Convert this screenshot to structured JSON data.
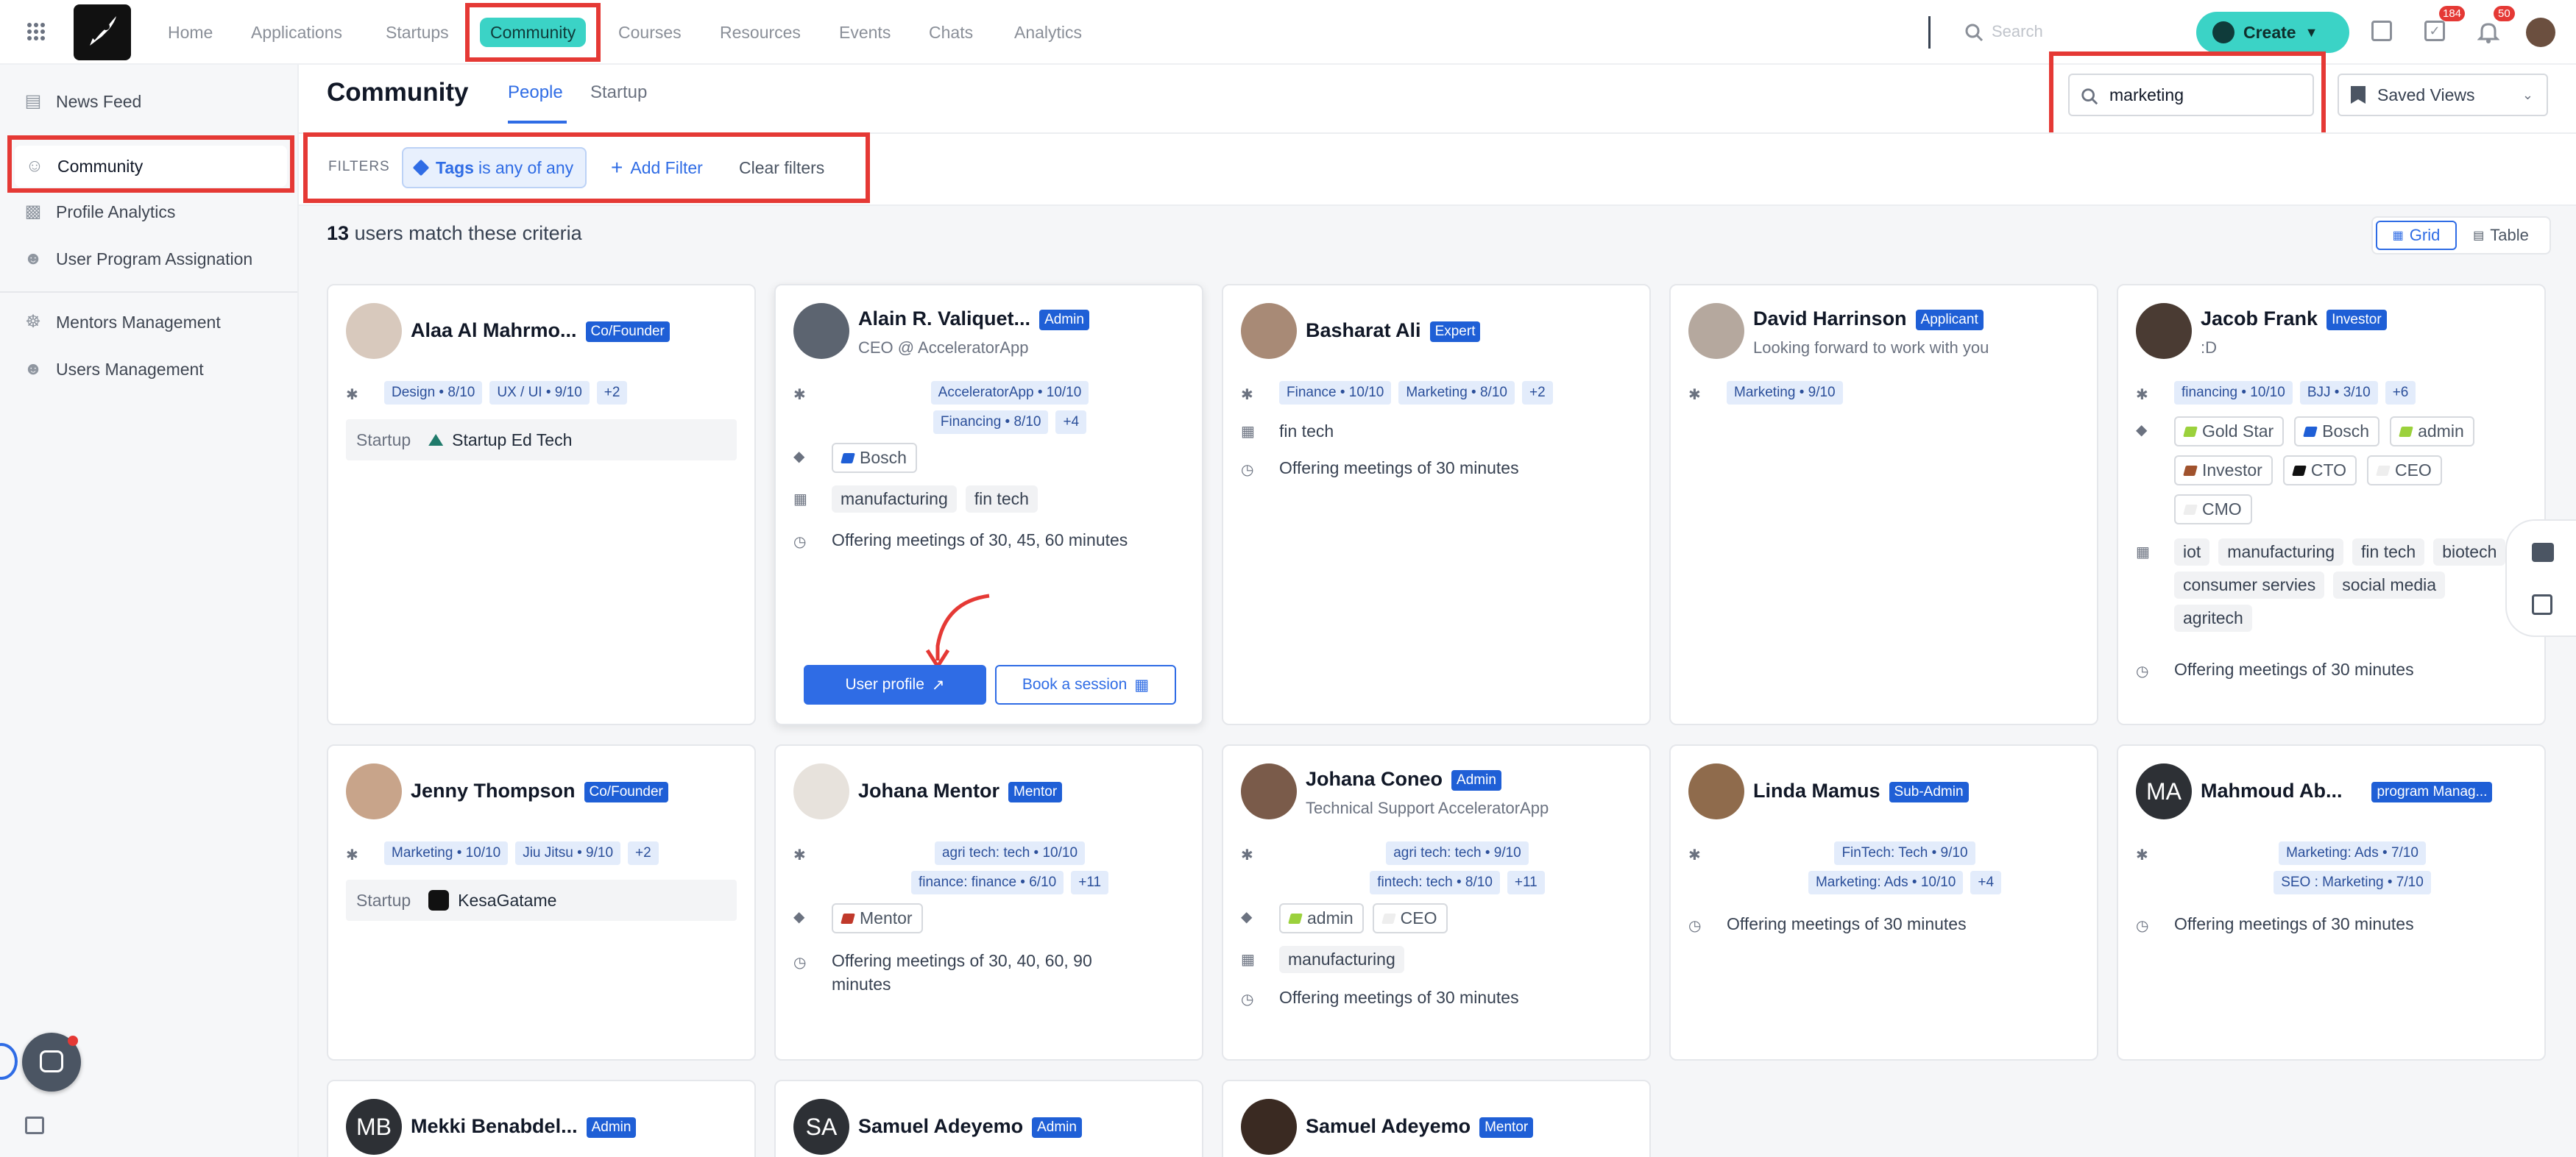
{
  "nav": {
    "items": [
      "Home",
      "Applications",
      "Startups",
      "Community",
      "Courses",
      "Resources",
      "Events",
      "Chats",
      "Analytics"
    ],
    "active": "Community",
    "search_placeholder": "Search",
    "create_label": "Create",
    "tasks_badge": "184",
    "notifications_badge": "50"
  },
  "sidebar": {
    "items": [
      "News Feed",
      "Community",
      "Profile Analytics",
      "User Program Assignation",
      "Mentors Management",
      "Users Management"
    ],
    "active": "Community"
  },
  "header": {
    "title": "Community",
    "tabs": [
      "People",
      "Startup"
    ],
    "active_tab": "People",
    "search_value": "marketing",
    "saved_views": "Saved Views"
  },
  "filters": {
    "label": "FILTERS",
    "tag_filter_key": "Tags",
    "tag_filter_rest": "is any of any",
    "add_filter": "Add Filter",
    "clear_filters": "Clear filters"
  },
  "results": {
    "count": "13",
    "text": "users match these criteria",
    "view_grid": "Grid",
    "view_table": "Table"
  },
  "colors": {
    "accent": "#2f6ce5",
    "nav_active": "#3bd3c6",
    "create": "#3bd3c6",
    "role_badge": "#1f5fd6",
    "highlight_box": "#e53935"
  },
  "cards": [
    {
      "name": "Alaa Al Mahrmo...",
      "role": "Co/Founder",
      "subtitle": "",
      "skills": [
        "Design • 8/10",
        "UX / UI • 9/10",
        "+2"
      ],
      "tags": [],
      "industries": [],
      "meetings": "",
      "startup_label": "Startup",
      "startup": "Startup Ed Tech"
    },
    {
      "name": "Alain R. Valiquet...",
      "role": "Admin",
      "subtitle": "CEO @ AcceleratorApp",
      "skills": [
        "AcceleratorApp • 10/10",
        "Financing • 8/10",
        "+4"
      ],
      "tags": [
        "Bosch"
      ],
      "industries": [
        "manufacturing",
        "fin tech"
      ],
      "meetings": "Offering meetings of 30, 45, 60 minutes",
      "btn_profile": "User profile",
      "btn_book": "Book a session"
    },
    {
      "name": "Basharat Ali",
      "role": "Expert",
      "subtitle": "",
      "skills": [
        "Finance • 10/10",
        "Marketing • 8/10",
        "+2"
      ],
      "tags": [],
      "industries": [
        "fin tech"
      ],
      "meetings": "Offering meetings of 30 minutes"
    },
    {
      "name": "David Harrinson",
      "role": "Applicant",
      "subtitle": "Looking forward to work with you",
      "skills": [
        "Marketing • 9/10"
      ],
      "tags": [],
      "industries": [],
      "meetings": ""
    },
    {
      "name": "Jacob Frank",
      "role": "Investor",
      "subtitle": ":D",
      "skills": [
        "financing • 10/10",
        "BJJ • 3/10",
        "+6"
      ],
      "tags": [
        "Gold Star",
        "Bosch",
        "admin",
        "Investor",
        "CTO",
        "CEO",
        "CMO"
      ],
      "industries": [
        "iot",
        "manufacturing",
        "fin tech",
        "biotech",
        "consumer servies",
        "social media",
        "agritech"
      ],
      "meetings": "Offering meetings of 30 minutes"
    },
    {
      "name": "Jenny Thompson",
      "role": "Co/Founder",
      "subtitle": "",
      "skills": [
        "Marketing • 10/10",
        "Jiu Jitsu • 9/10",
        "+2"
      ],
      "tags": [],
      "industries": [],
      "meetings": "",
      "startup_label": "Startup",
      "startup": "KesaGatame"
    },
    {
      "name": "Johana Mentor",
      "role": "Mentor",
      "subtitle": "",
      "skills": [
        "agri tech: tech • 10/10",
        "finance: finance • 6/10",
        "+11"
      ],
      "tags": [
        "Mentor"
      ],
      "industries": [],
      "meetings": "Offering meetings of 30, 40, 60, 90 minutes"
    },
    {
      "name": "Johana Coneo",
      "role": "Admin",
      "subtitle": "Technical Support AcceleratorApp",
      "skills": [
        "agri tech: tech • 9/10",
        "fintech: tech • 8/10",
        "+11"
      ],
      "tags": [
        "admin",
        "CEO"
      ],
      "industries": [
        "manufacturing"
      ],
      "meetings": "Offering meetings of 30 minutes"
    },
    {
      "name": "Linda Mamus",
      "role": "Sub-Admin",
      "subtitle": "",
      "skills": [
        "FinTech: Tech • 9/10",
        "Marketing: Ads • 10/10",
        "+4"
      ],
      "tags": [],
      "industries": [],
      "meetings": "Offering meetings of 30 minutes"
    },
    {
      "name": "Mahmoud Ab...",
      "role": "program Manag...",
      "subtitle": "",
      "initials": "MA",
      "skills": [
        "Marketing: Ads • 7/10",
        "SEO : Marketing • 7/10"
      ],
      "tags": [],
      "industries": [],
      "meetings": "Offering meetings of 30 minutes"
    },
    {
      "name": "Mekki Benabdel...",
      "role": "Admin",
      "initials": "MB"
    },
    {
      "name": "Samuel Adeyemo",
      "role": "Admin",
      "initials": "SA"
    },
    {
      "name": "Samuel Adeyemo",
      "role": "Mentor"
    }
  ]
}
